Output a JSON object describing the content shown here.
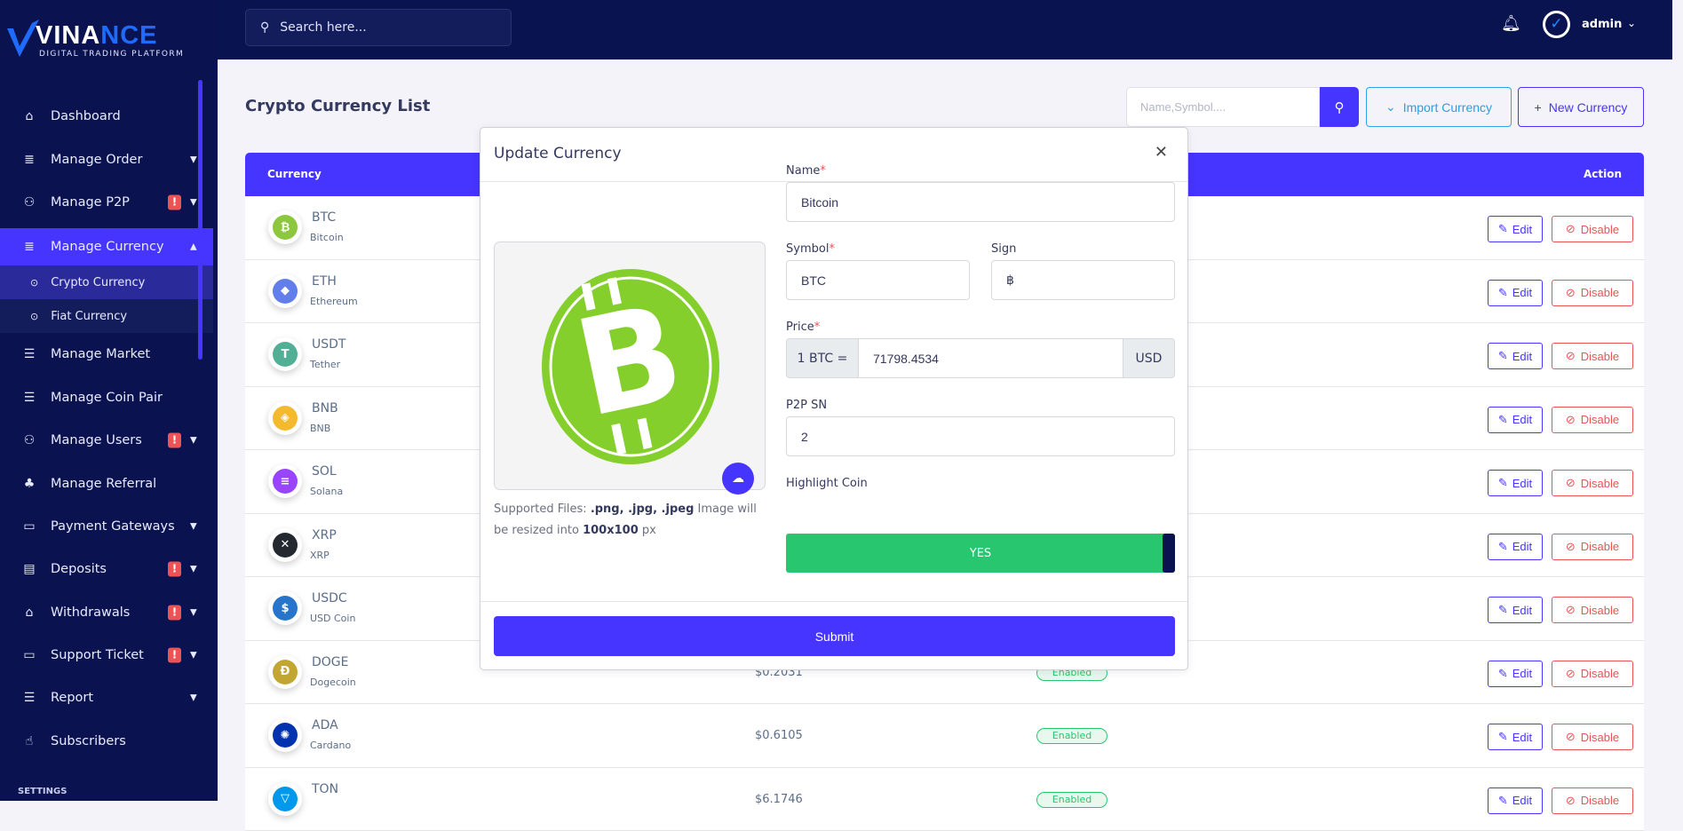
{
  "brand": {
    "name_part1": "VINA",
    "name_part2": "NCE",
    "tagline": "DIGITAL TRADING PLATFORM"
  },
  "topbar": {
    "search_placeholder": "Search here...",
    "user": "admin"
  },
  "sidebar": {
    "items": [
      {
        "label": "Dashboard",
        "icon": "home-icon",
        "glyph": "⌂"
      },
      {
        "label": "Manage Order",
        "icon": "coins-icon",
        "glyph": "≣",
        "chevron": true
      },
      {
        "label": "Manage P2P",
        "icon": "users-icon",
        "glyph": "⚇",
        "chevron": true,
        "alert": true
      },
      {
        "label": "Manage Currency",
        "icon": "coins-icon",
        "glyph": "≣",
        "chevron": true,
        "active": true,
        "open": true,
        "children": [
          {
            "label": "Crypto Currency",
            "active": true
          },
          {
            "label": "Fiat Currency"
          }
        ]
      },
      {
        "label": "Manage Market",
        "icon": "list-icon",
        "glyph": "☰"
      },
      {
        "label": "Manage Coin Pair",
        "icon": "list-icon",
        "glyph": "☰"
      },
      {
        "label": "Manage Users",
        "icon": "users-icon",
        "glyph": "⚇",
        "chevron": true,
        "alert": true
      },
      {
        "label": "Manage Referral",
        "icon": "tree-icon",
        "glyph": "♣"
      },
      {
        "label": "Payment Gateways",
        "icon": "credit-card-icon",
        "glyph": "▭",
        "chevron": true
      },
      {
        "label": "Deposits",
        "icon": "invoice-icon",
        "glyph": "▤",
        "chevron": true,
        "alert": true
      },
      {
        "label": "Withdrawals",
        "icon": "bank-icon",
        "glyph": "⌂",
        "chevron": true,
        "alert": true
      },
      {
        "label": "Support Ticket",
        "icon": "ticket-icon",
        "glyph": "▭",
        "chevron": true,
        "alert": true
      },
      {
        "label": "Report",
        "icon": "list-icon",
        "glyph": "☰",
        "chevron": true
      },
      {
        "label": "Subscribers",
        "icon": "thumbs-up-icon",
        "glyph": "☝"
      }
    ],
    "section_label": "SETTINGS"
  },
  "page": {
    "title": "Crypto Currency List",
    "search_placeholder": "Name,Symbol....",
    "import_label": "Import Currency",
    "new_label": "New Currency"
  },
  "table": {
    "headers": {
      "currency": "Currency",
      "action": "Action"
    },
    "edit_label": "Edit",
    "disable_label": "Disable",
    "rows": [
      {
        "symbol": "BTC",
        "name": "Bitcoin",
        "color": "#8dc63f",
        "glyph": "₿"
      },
      {
        "symbol": "ETH",
        "name": "Ethereum",
        "color": "#627eea",
        "glyph": "◆"
      },
      {
        "symbol": "USDT",
        "name": "Tether",
        "color": "#50af95",
        "glyph": "T"
      },
      {
        "symbol": "BNB",
        "name": "BNB",
        "color": "#f3ba2f",
        "glyph": "◈"
      },
      {
        "symbol": "SOL",
        "name": "Solana",
        "color": "#9945ff",
        "glyph": "≡"
      },
      {
        "symbol": "XRP",
        "name": "XRP",
        "color": "#23292f",
        "glyph": "✕"
      },
      {
        "symbol": "USDC",
        "name": "USD Coin",
        "color": "#2775ca",
        "glyph": "$"
      },
      {
        "symbol": "DOGE",
        "name": "Dogecoin",
        "color": "#c2a633",
        "glyph": "Ð",
        "price": "$0.2031",
        "status": "Enabled"
      },
      {
        "symbol": "ADA",
        "name": "Cardano",
        "color": "#0033ad",
        "glyph": "✺",
        "price": "$0.6105",
        "status": "Enabled"
      },
      {
        "symbol": "TON",
        "name": "",
        "color": "#0098ea",
        "glyph": "▽",
        "price": "$6.1746",
        "status": "Enabled"
      }
    ]
  },
  "modal": {
    "title": "Update Currency",
    "name_label": "Name",
    "name_value": "Bitcoin",
    "symbol_label": "Symbol",
    "symbol_value": "BTC",
    "sign_label": "Sign",
    "sign_value": "฿",
    "price_label": "Price",
    "price_prefix": "1 BTC =",
    "price_value": "71798.4534",
    "price_suffix": "USD",
    "p2p_label": "P2P SN",
    "p2p_value": "2",
    "highlight_label": "Highlight Coin",
    "highlight_value": "YES",
    "caption_1": "Supported Files: ",
    "caption_files": ".png, .jpg, .jpeg",
    "caption_2": " Image will be resized into ",
    "caption_size": "100x100",
    "caption_3": " px",
    "submit_label": "Submit",
    "required_mark": "*"
  },
  "colors": {
    "accent": "#4634ff",
    "sidebar": "#0a1350",
    "success": "#28c76f",
    "danger": "#ea5455"
  }
}
